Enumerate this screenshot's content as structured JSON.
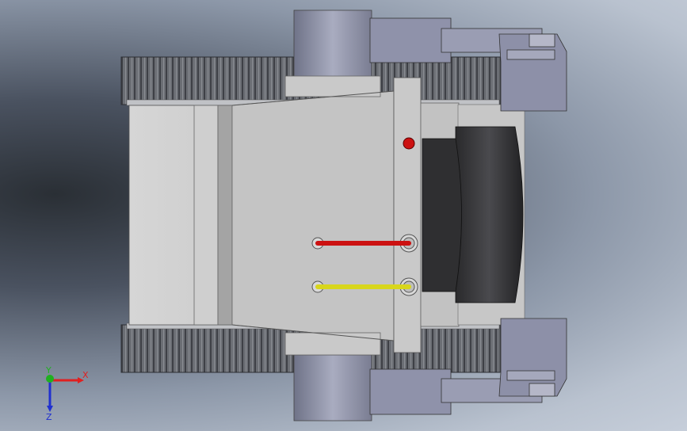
{
  "view": {
    "background_colors": [
      "#2a2f35",
      "#8c97a8",
      "#c6ceda"
    ]
  },
  "model": {
    "body_color": "#c8c8c8",
    "track_color": "#5e6168",
    "bracket_color": "#8d90a8",
    "wheel_color": "#3b3b3d",
    "accent_red": "#cc1111",
    "accent_yellow": "#d8d61c"
  },
  "triad": {
    "x_label": "X",
    "y_label": "Y",
    "z_label": "Z",
    "x_color": "#e02020",
    "y_color": "#20b020",
    "z_color": "#2030d0"
  }
}
